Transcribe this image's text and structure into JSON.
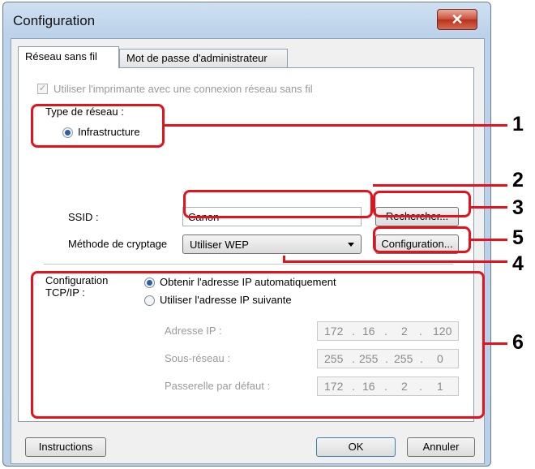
{
  "window": {
    "title": "Configuration",
    "close_glyph": "✕"
  },
  "tabs": [
    {
      "label": "Réseau sans fil",
      "active": true
    },
    {
      "label": "Mot de passe d'administrateur",
      "active": false
    }
  ],
  "wireless": {
    "use_printer_label": "Utiliser l'imprimante avec une connexion réseau sans fil",
    "use_printer_checked": true,
    "network_type_label": "Type de réseau :",
    "network_type_value": "Infrastructure",
    "ssid_label": "SSID :",
    "ssid_value": "Canon",
    "search_button": "Rechercher...",
    "encryption_label": "Méthode de cryptage",
    "encryption_value": "Utiliser WEP",
    "config_button": "Configuration..."
  },
  "tcpip": {
    "label_line1": "Configuration",
    "label_line2": "TCP/IP :",
    "auto_option": "Obtenir l'adresse IP automatiquement",
    "manual_option": "Utiliser l'adresse IP suivante",
    "selected": "auto",
    "ip_label": "Adresse IP :",
    "ip": [
      "172",
      "16",
      "2",
      "120"
    ],
    "subnet_label": "Sous-réseau :",
    "subnet": [
      "255",
      "255",
      "255",
      "0"
    ],
    "gateway_label": "Passerelle par défaut :",
    "gateway": [
      "172",
      "16",
      "2",
      "1"
    ]
  },
  "footer": {
    "instructions_button": "Instructions",
    "ok_button": "OK",
    "cancel_button": "Annuler"
  },
  "callouts": [
    "1",
    "2",
    "3",
    "4",
    "5",
    "6"
  ],
  "colors": {
    "callout_red": "#e3121d",
    "title_gradient": "#bcd2ea",
    "close_red": "#c8503a"
  }
}
